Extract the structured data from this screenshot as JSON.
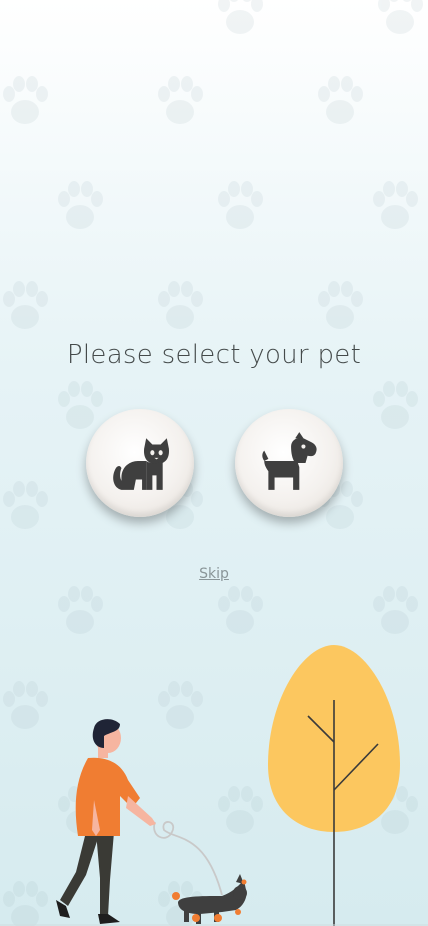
{
  "prompt": {
    "title": "Please select your pet"
  },
  "pets": [
    {
      "id": "cat",
      "icon": "cat-icon"
    },
    {
      "id": "dog",
      "icon": "dog-icon"
    }
  ],
  "skip": {
    "label": "Skip"
  },
  "colors": {
    "icon": "#3f3f3f",
    "shirt": "#f07d32",
    "tree": "#fcc75f",
    "text": "#444a4a"
  }
}
